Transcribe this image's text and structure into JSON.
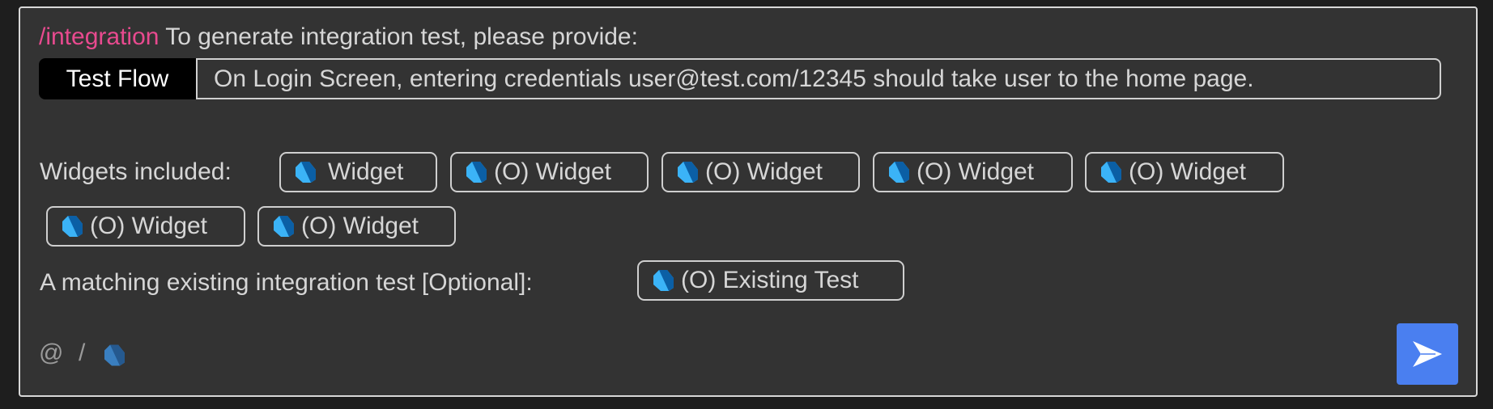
{
  "prompt": {
    "command": "/integration",
    "instruction": "To generate integration test, please provide:"
  },
  "test_flow": {
    "label": "Test Flow",
    "value": "On Login Screen, entering credentials user@test.com/12345 should take  user to the home page."
  },
  "widgets": {
    "label": "Widgets included:",
    "chips": [
      {
        "label": "Widget",
        "icon": "dart-icon"
      },
      {
        "label": "(O) Widget",
        "icon": "dart-icon"
      },
      {
        "label": "(O) Widget",
        "icon": "dart-icon"
      },
      {
        "label": "(O) Widget",
        "icon": "dart-icon"
      },
      {
        "label": "(O) Widget",
        "icon": "dart-icon"
      },
      {
        "label": "(O) Widget",
        "icon": "dart-icon"
      },
      {
        "label": "(O) Widget",
        "icon": "dart-icon"
      }
    ]
  },
  "existing_test": {
    "label": "A matching existing integration test [Optional]:",
    "chip": {
      "label": "(O) Existing Test",
      "icon": "dart-icon"
    }
  },
  "footer": {
    "mention_symbol": "@",
    "command_symbol": "/",
    "context_icon": "dart-icon",
    "send_icon": "send-icon"
  },
  "colors": {
    "command": "#e84a8f",
    "send_button": "#4a7ff0",
    "panel_bg": "#333333",
    "page_bg": "#1e1e1e",
    "dart_light": "#3bb3f7",
    "dart_dark": "#0b5fa5"
  }
}
